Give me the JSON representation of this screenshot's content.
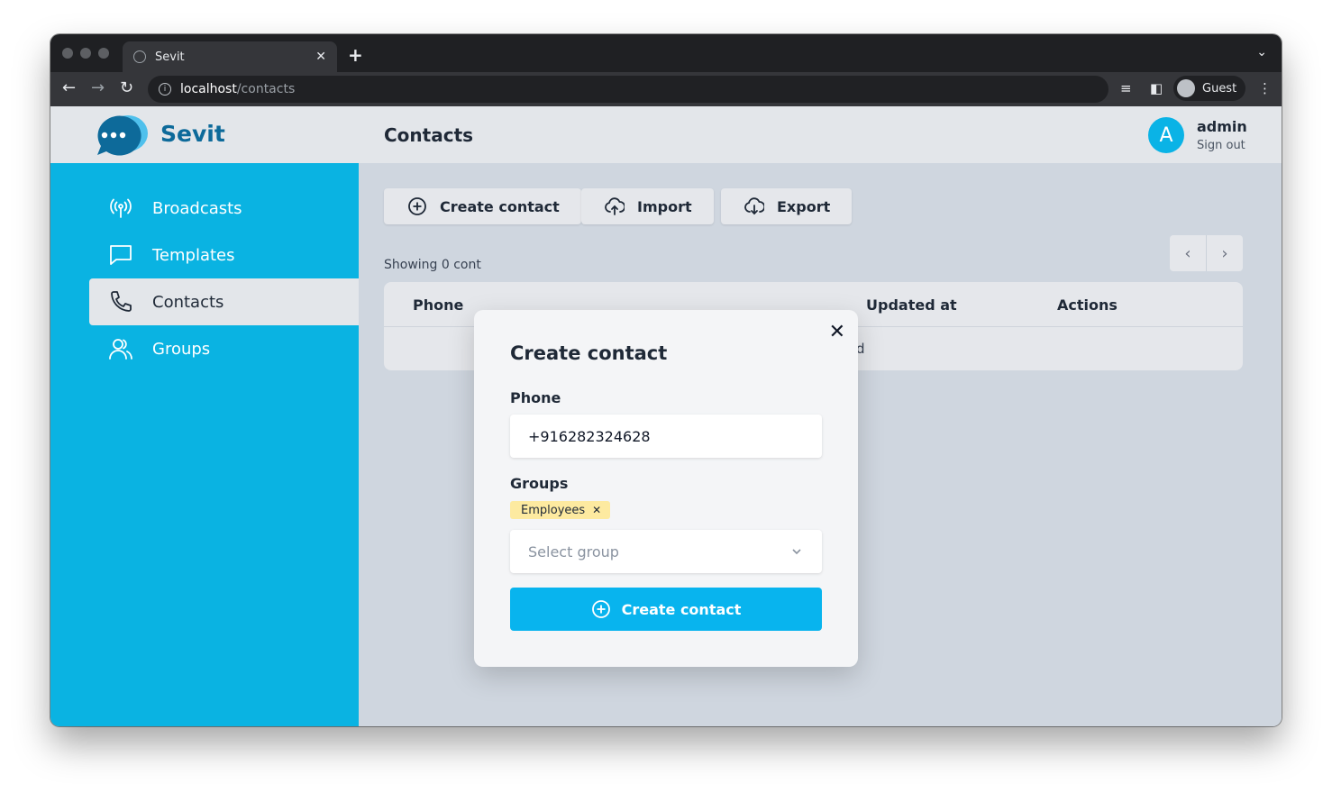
{
  "browser": {
    "tab_title": "Sevit",
    "url_host": "localhost",
    "url_path": "/contacts",
    "profile_label": "Guest"
  },
  "app": {
    "brand": "Sevit",
    "page_title": "Contacts",
    "user": {
      "initial": "A",
      "name": "admin",
      "sign_out": "Sign out"
    }
  },
  "sidebar": {
    "items": [
      {
        "label": "Broadcasts",
        "icon": "broadcast-icon"
      },
      {
        "label": "Templates",
        "icon": "chat-bubble-icon"
      },
      {
        "label": "Contacts",
        "icon": "phone-icon",
        "active": true
      },
      {
        "label": "Groups",
        "icon": "users-icon"
      }
    ]
  },
  "toolbar": {
    "create_label": "Create contact",
    "import_label": "Import",
    "export_label": "Export"
  },
  "list": {
    "showing": "Showing 0 cont",
    "columns": [
      "Phone",
      "Updated at",
      "Actions"
    ],
    "empty_fragment": "d"
  },
  "modal": {
    "title": "Create contact",
    "phone_label": "Phone",
    "phone_value": "+916282324628",
    "groups_label": "Groups",
    "selected_groups": [
      "Employees"
    ],
    "group_placeholder": "Select group",
    "submit_label": "Create contact"
  },
  "colors": {
    "sidebar": "#0ab3e2",
    "accent": "#08b4ee",
    "brand": "#0d6a9a",
    "chip": "#fdeaa0"
  }
}
